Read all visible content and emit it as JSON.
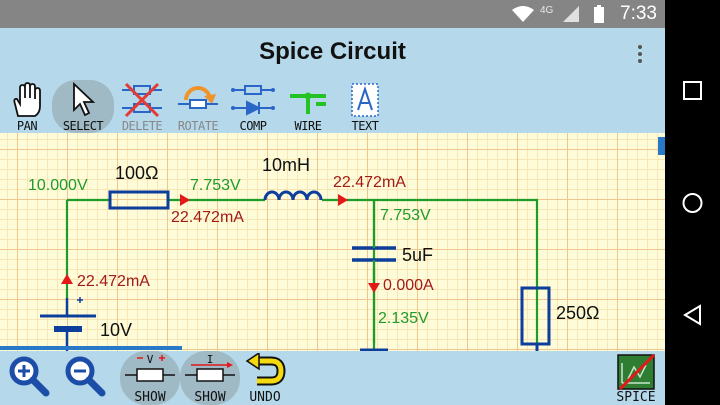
{
  "status": {
    "network": "4G",
    "time": "7:33"
  },
  "app": {
    "title": "Spice Circuit"
  },
  "toolbar": {
    "pan": "PAN",
    "select": "SELECT",
    "delete": "DELETE",
    "rotate": "ROTATE",
    "comp": "COMP",
    "wire": "WIRE",
    "text": "TEXT"
  },
  "circuit": {
    "source_voltage": "10.000V",
    "resistor1": "100Ω",
    "node2_voltage": "7.753V",
    "inductor": "10mH",
    "inductor_current": "22.472mA",
    "resistor1_current": "22.472mA",
    "node3_voltage": "7.753V",
    "capacitor": "5uF",
    "capacitor_current": "0.000A",
    "capacitor_voltage": "2.135V",
    "source_current": "22.472mA",
    "battery": "10V",
    "resistor2": "250Ω"
  },
  "bottombar": {
    "show_voltage": "SHOW",
    "show_current": "SHOW",
    "undo": "UNDO",
    "spice": "SPICE",
    "v_mark": "V",
    "i_mark": "I"
  }
}
